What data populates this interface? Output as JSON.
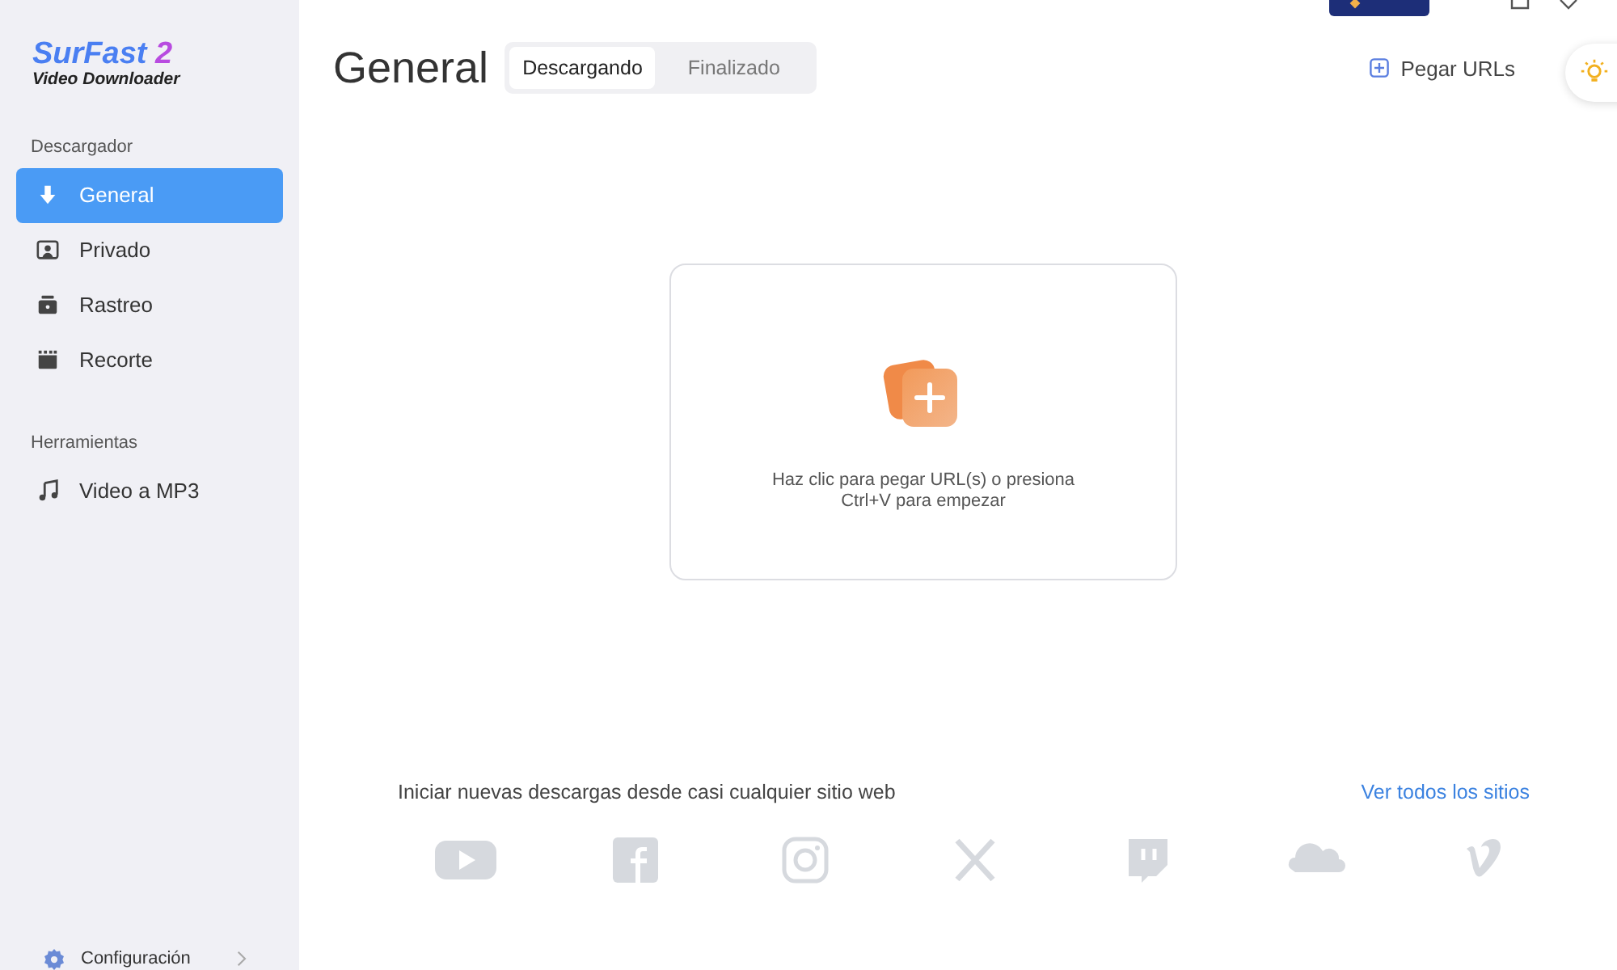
{
  "logo": {
    "name": "SurFast",
    "version": "2",
    "subtitle": "Video Downloader"
  },
  "sidebar": {
    "sections": [
      {
        "heading": "Descargador",
        "items": [
          {
            "label": "General",
            "kind": "download",
            "selected": true
          },
          {
            "label": "Privado",
            "kind": "private",
            "selected": false
          },
          {
            "label": "Rastreo",
            "kind": "track",
            "selected": false
          },
          {
            "label": "Recorte",
            "kind": "cut",
            "selected": false
          }
        ]
      },
      {
        "heading": "Herramientas",
        "items": [
          {
            "label": "Video a MP3",
            "kind": "music",
            "selected": false
          }
        ]
      }
    ],
    "settings": "Configuración"
  },
  "header": {
    "title": "General",
    "tabs": [
      {
        "label": "Descargando",
        "selected": true
      },
      {
        "label": "Finalizado",
        "selected": false
      }
    ],
    "paste_button": "Pegar URLs"
  },
  "drop_zone": {
    "hint": "Haz clic para pegar URL(s) o presiona Ctrl+V para empezar"
  },
  "sites": {
    "text": "Iniciar nuevas descargas desde casi cualquier sitio web",
    "link": "Ver todos los sitios"
  }
}
